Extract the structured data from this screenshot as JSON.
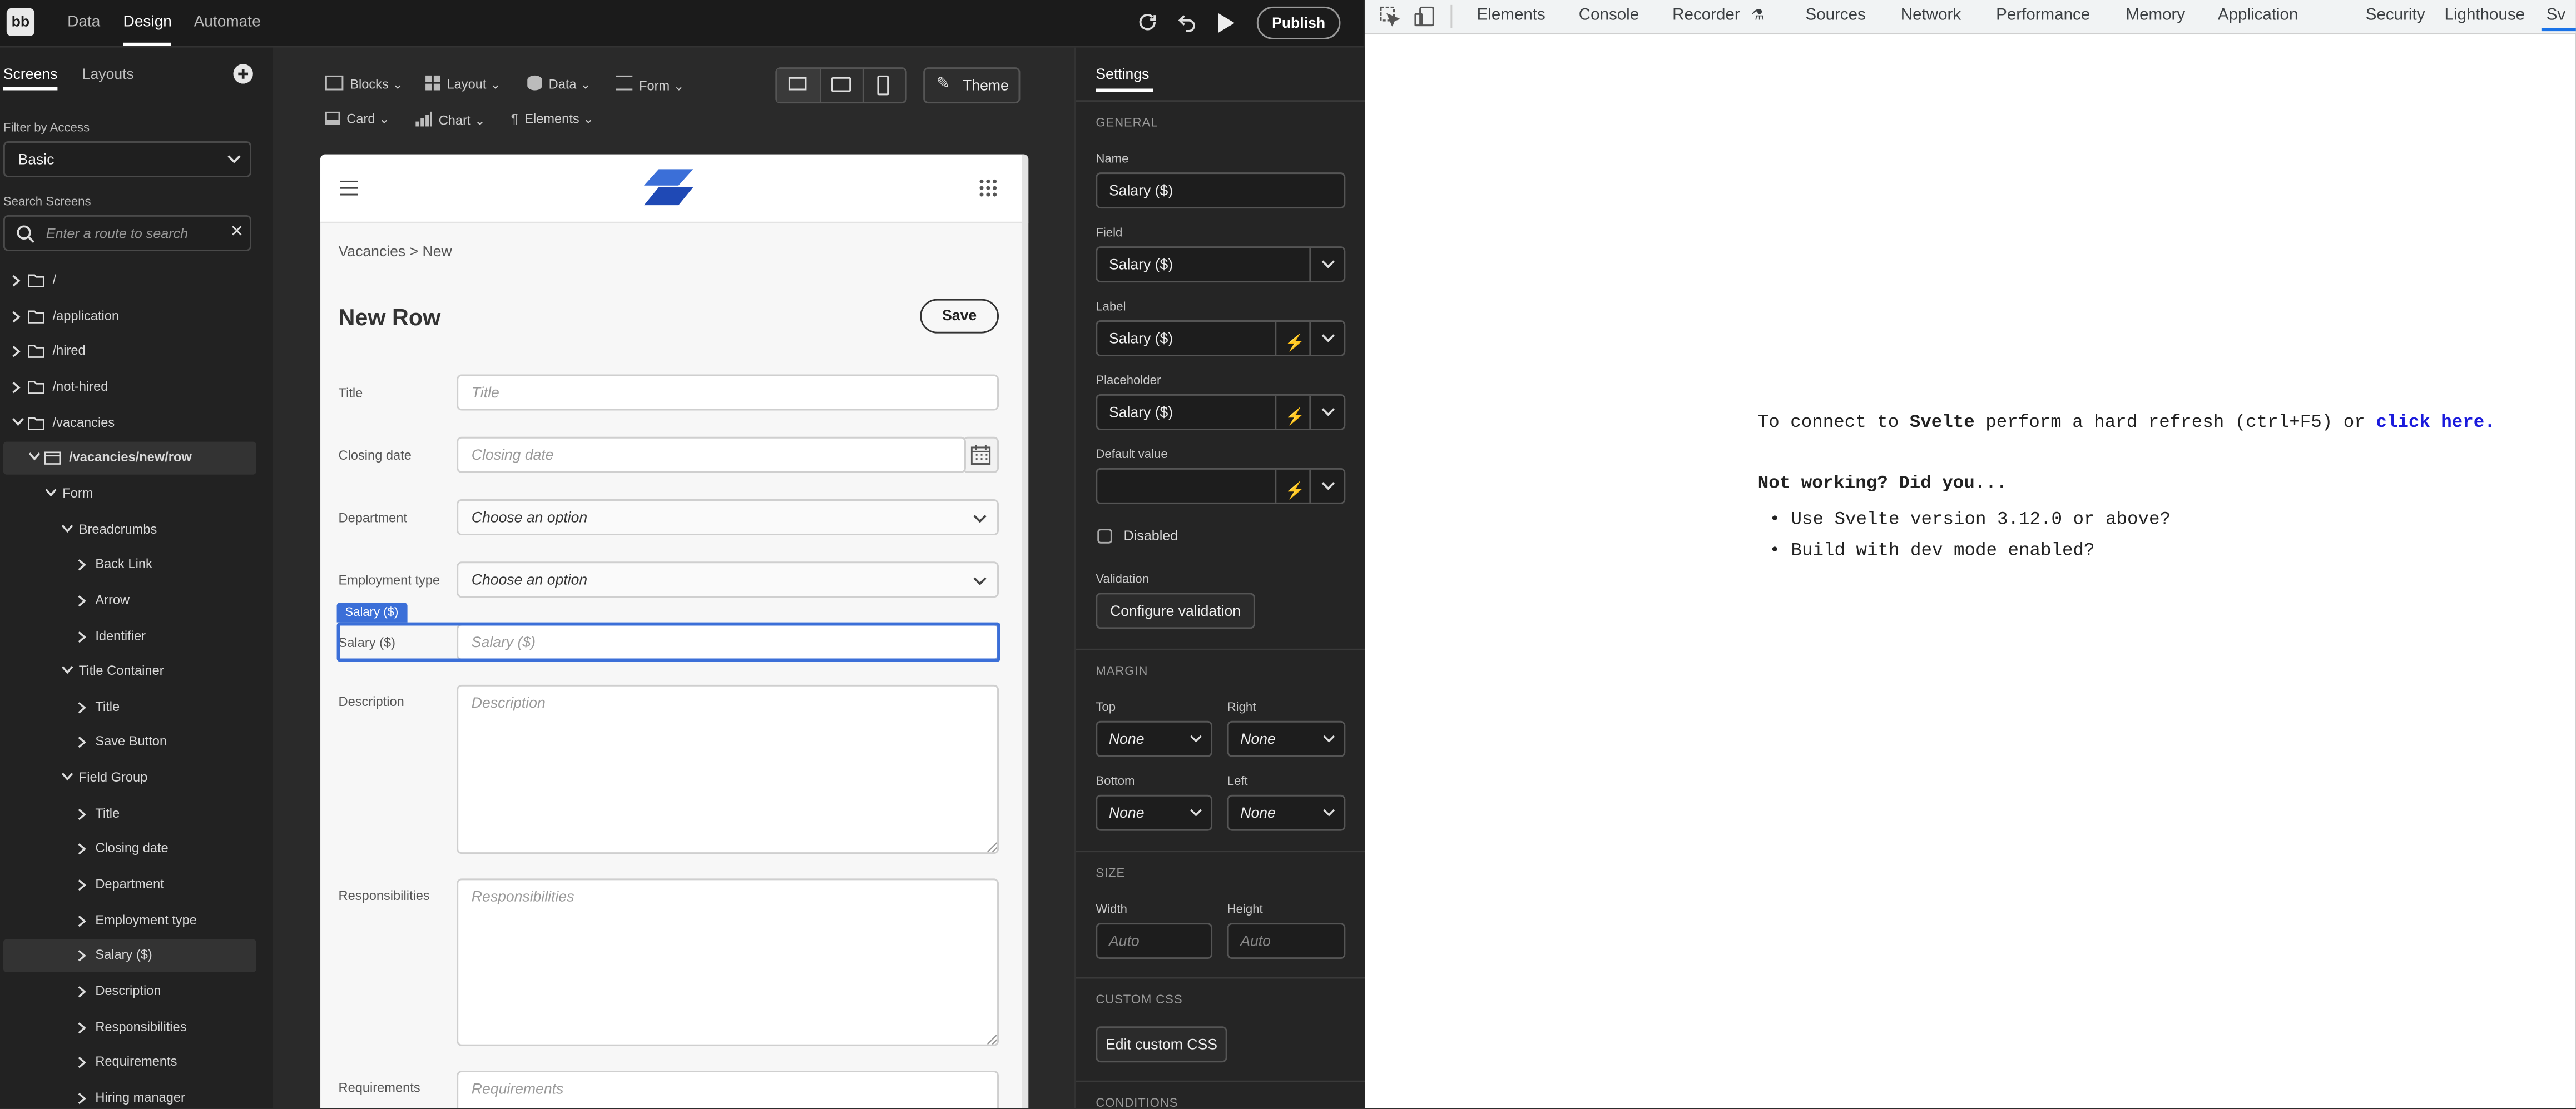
{
  "app": {
    "logo": "bb",
    "tabs": [
      {
        "label": "Data"
      },
      {
        "label": "Design",
        "active": true
      },
      {
        "label": "Automate"
      }
    ],
    "publish_label": "Publish"
  },
  "left": {
    "tabs": [
      "Screens",
      "Layouts"
    ],
    "filter_label": "Filter by Access",
    "filter_value": "Basic",
    "search_label": "Search Screens",
    "search_placeholder": "Enter a route to search",
    "tree": [
      {
        "label": "/",
        "depth": 0,
        "type": "folder"
      },
      {
        "label": "/application",
        "depth": 0,
        "type": "folder"
      },
      {
        "label": "/hired",
        "depth": 0,
        "type": "folder"
      },
      {
        "label": "/not-hired",
        "depth": 0,
        "type": "folder"
      },
      {
        "label": "/vacancies",
        "depth": 0,
        "type": "folder",
        "open": true
      },
      {
        "label": "/vacancies/new/row",
        "depth": 1,
        "type": "screen",
        "open": true,
        "selected": true,
        "bold": true
      },
      {
        "label": "Form",
        "depth": 2,
        "open": true
      },
      {
        "label": "Breadcrumbs",
        "depth": 3,
        "open": true
      },
      {
        "label": "Back Link",
        "depth": 4
      },
      {
        "label": "Arrow",
        "depth": 4
      },
      {
        "label": "Identifier",
        "depth": 4
      },
      {
        "label": "Title Container",
        "depth": 3,
        "open": true
      },
      {
        "label": "Title",
        "depth": 4
      },
      {
        "label": "Save Button",
        "depth": 4
      },
      {
        "label": "Field Group",
        "depth": 3,
        "open": true
      },
      {
        "label": "Title",
        "depth": 4
      },
      {
        "label": "Closing date",
        "depth": 4
      },
      {
        "label": "Department",
        "depth": 4
      },
      {
        "label": "Employment type",
        "depth": 4
      },
      {
        "label": "Salary ($)",
        "depth": 4,
        "selected": true
      },
      {
        "label": "Description",
        "depth": 4
      },
      {
        "label": "Responsibilities",
        "depth": 4
      },
      {
        "label": "Requirements",
        "depth": 4
      },
      {
        "label": "Hiring manager",
        "depth": 4
      }
    ]
  },
  "toolbar": {
    "items_row1": [
      "Blocks",
      "Layout",
      "Data",
      "Form"
    ],
    "items_row2": [
      "Card",
      "Chart",
      "Elements"
    ],
    "theme_label": "Theme"
  },
  "preview": {
    "breadcrumb": "Vacancies > New",
    "title": "New Row",
    "save_label": "Save",
    "fields": [
      {
        "label": "Title",
        "placeholder": "Title",
        "kind": "text"
      },
      {
        "label": "Closing date",
        "placeholder": "Closing date",
        "kind": "date"
      },
      {
        "label": "Department",
        "placeholder": "Choose an option",
        "kind": "select"
      },
      {
        "label": "Employment type",
        "placeholder": "Choose an option",
        "kind": "select"
      },
      {
        "label": "Salary ($)",
        "placeholder": "Salary ($)",
        "kind": "text",
        "selected": true
      },
      {
        "label": "Description",
        "placeholder": "Description",
        "kind": "textarea"
      },
      {
        "label": "Responsibilities",
        "placeholder": "Responsibilities",
        "kind": "textarea"
      },
      {
        "label": "Requirements",
        "placeholder": "Requirements",
        "kind": "textarea"
      }
    ],
    "selected_tag": "Salary ($)"
  },
  "settings": {
    "tab": "Settings",
    "general_label": "GENERAL",
    "name_label": "Name",
    "name_value": "Salary ($)",
    "field_label": "Field",
    "field_value": "Salary ($)",
    "label_label": "Label",
    "label_value": "Salary ($)",
    "placeholder_label": "Placeholder",
    "placeholder_value": "Salary ($)",
    "default_label": "Default value",
    "default_value": "",
    "disabled_label": "Disabled",
    "validation_label": "Validation",
    "validation_button": "Configure validation",
    "margin_label": "MARGIN",
    "top_label": "Top",
    "right_label": "Right",
    "bottom_label": "Bottom",
    "left_label": "Left",
    "margin_value": "None",
    "size_label": "SIZE",
    "width_label": "Width",
    "height_label": "Height",
    "size_placeholder": "Auto",
    "css_label": "CUSTOM CSS",
    "css_button": "Edit custom CSS",
    "conditions_label": "CONDITIONS"
  },
  "devtools": {
    "tabs": [
      "Elements",
      "Console",
      "Recorder",
      "Sources",
      "Network",
      "Performance",
      "Memory",
      "Application",
      "Security",
      "Lighthouse",
      "Sv"
    ],
    "msg_pre": "To connect to ",
    "msg_bold": "Svelte",
    "msg_mid": " perform a hard refresh (ctrl+F5) or ",
    "msg_link": "click here.",
    "not_working": "Not working? Did you...",
    "bullets": [
      "Use Svelte version 3.12.0 or above?",
      "Build with dev mode enabled?"
    ]
  },
  "colors": {
    "accent": "#3b6fd8",
    "brand_blue": "#2a5bd7",
    "panel": "#222222",
    "topbar": "#1b1b1b"
  }
}
